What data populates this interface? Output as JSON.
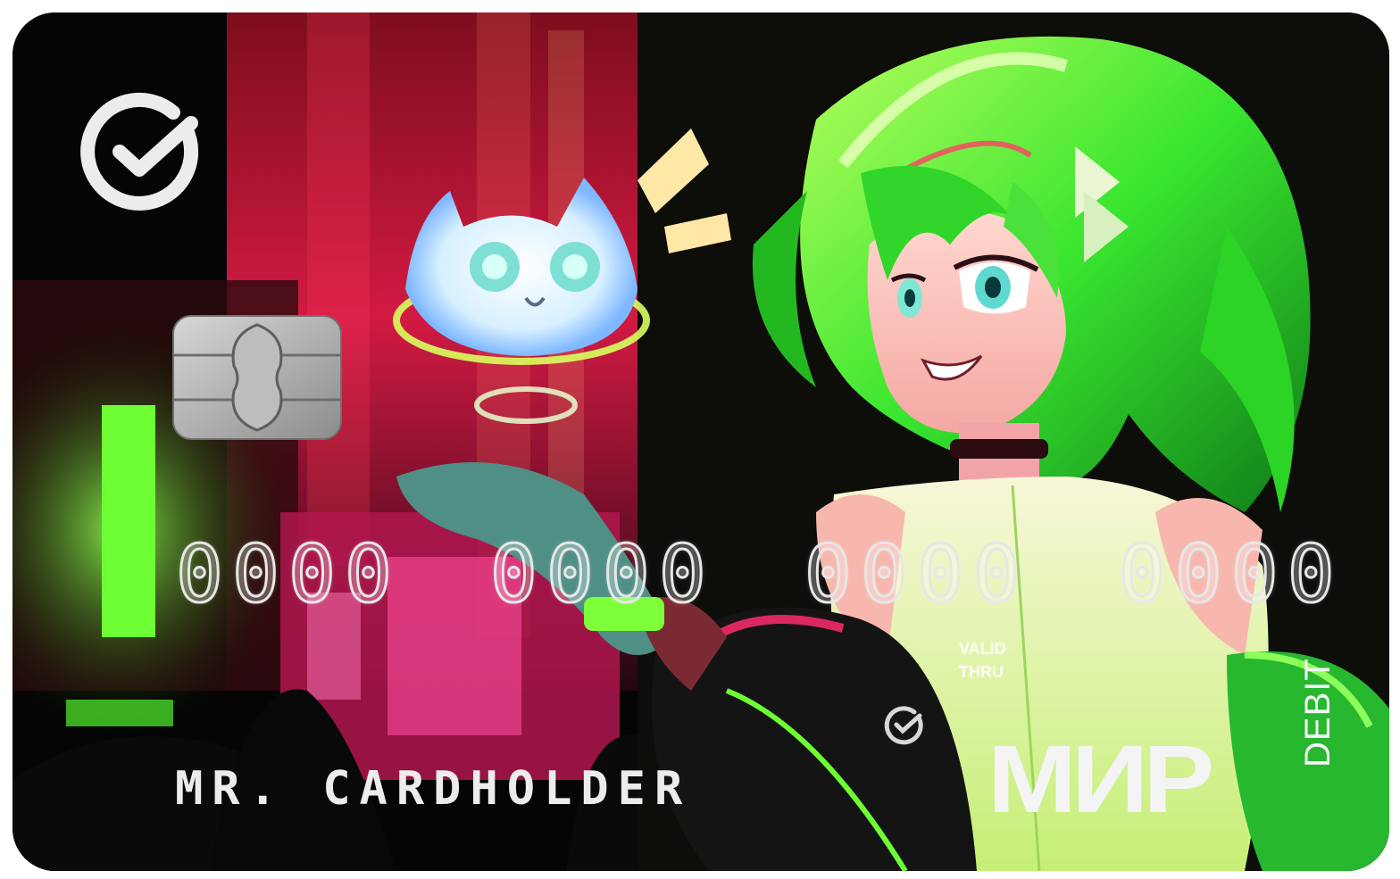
{
  "card": {
    "number_groups": [
      "0000",
      "0000",
      "0000",
      "0000"
    ],
    "holder_name": "MR. CARDHOLDER",
    "valid_label_line1": "VALID",
    "valid_label_line2": "THRU",
    "payment_system": "МИР",
    "card_type": "DEBIT"
  },
  "icons": {
    "bank_logo": "sber-check-logo-icon",
    "chip": "emv-chip-icon",
    "small_logo": "sber-check-logo-icon"
  },
  "colors": {
    "card_background": "#050505",
    "neon_green": "#54ff34",
    "neon_pink": "#ff2b6d",
    "card_text": "#ececec"
  }
}
